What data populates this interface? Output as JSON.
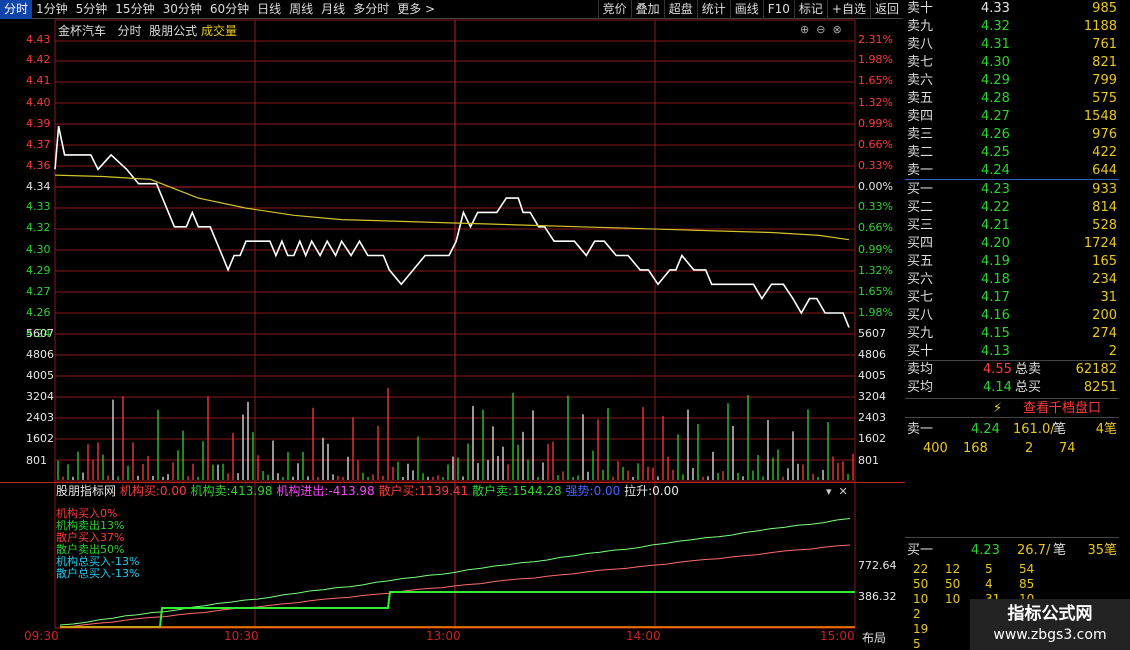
{
  "toolbar": {
    "periods": [
      "分时",
      "1分钟",
      "5分钟",
      "15分钟",
      "30分钟",
      "60分钟",
      "日线",
      "周线",
      "月线",
      "多分时",
      "更多 >"
    ],
    "tools": [
      "竞价",
      "叠加",
      "超盘",
      "统计",
      "画线",
      "F10",
      "标记",
      "+自选",
      "返回"
    ]
  },
  "title": {
    "stock": "金杯汽车",
    "mode": "分时",
    "indicator": "股朋公式",
    "vol_label": "成交量"
  },
  "price_axis": {
    "left": [
      "4.43",
      "4.42",
      "4.41",
      "4.40",
      "4.39",
      "4.37",
      "4.36",
      "4.34",
      "4.33",
      "4.32",
      "4.30",
      "4.29",
      "4.27",
      "4.26",
      "4.24"
    ],
    "right": [
      "2.31%",
      "1.98%",
      "1.65%",
      "1.32%",
      "0.99%",
      "0.66%",
      "0.33%",
      "0.00%",
      "0.33%",
      "0.66%",
      "0.99%",
      "1.32%",
      "1.65%",
      "1.98%"
    ]
  },
  "volume_axis": [
    "5607",
    "4806",
    "4005",
    "3204",
    "2403",
    "1602",
    "801"
  ],
  "indicator": {
    "name": "股朋指标网",
    "buy_label": "机构买:",
    "buy_val": "0.00",
    "sell_label": "机构卖:",
    "sell_val": "413.98",
    "net_label": "机构进出:",
    "net_val": "-413.98",
    "rbuy_label": "散户买:",
    "rbuy_val": "1139.41",
    "rsell_label": "散户卖:",
    "rsell_val": "1544.28",
    "strong_label": "强势:",
    "strong_val": "0.00",
    "pull_label": "拉升:",
    "pull_val": "0.00",
    "axis": [
      "772.64",
      "386.32"
    ],
    "legend": [
      "机构买入0%",
      "机构卖出13%",
      "散户买入37%",
      "散户卖出50%",
      "机构总买入-13%",
      "散户总买入-13%"
    ]
  },
  "time_axis": [
    "09:30",
    "10:30",
    "13:00",
    "14:00",
    "15:00"
  ],
  "layout_button": "布局",
  "orderbook": {
    "sell": [
      {
        "label": "卖十",
        "price": "4.33",
        "vol": "985"
      },
      {
        "label": "卖九",
        "price": "4.32",
        "vol": "1188"
      },
      {
        "label": "卖八",
        "price": "4.31",
        "vol": "761"
      },
      {
        "label": "卖七",
        "price": "4.30",
        "vol": "821"
      },
      {
        "label": "卖六",
        "price": "4.29",
        "vol": "799"
      },
      {
        "label": "卖五",
        "price": "4.28",
        "vol": "575"
      },
      {
        "label": "卖四",
        "price": "4.27",
        "vol": "1548"
      },
      {
        "label": "卖三",
        "price": "4.26",
        "vol": "976"
      },
      {
        "label": "卖二",
        "price": "4.25",
        "vol": "422"
      },
      {
        "label": "卖一",
        "price": "4.24",
        "vol": "644"
      }
    ],
    "buy": [
      {
        "label": "买一",
        "price": "4.23",
        "vol": "933"
      },
      {
        "label": "买二",
        "price": "4.22",
        "vol": "814"
      },
      {
        "label": "买三",
        "price": "4.21",
        "vol": "528"
      },
      {
        "label": "买四",
        "price": "4.20",
        "vol": "1724"
      },
      {
        "label": "买五",
        "price": "4.19",
        "vol": "165"
      },
      {
        "label": "买六",
        "price": "4.18",
        "vol": "234"
      },
      {
        "label": "买七",
        "price": "4.17",
        "vol": "31"
      },
      {
        "label": "买八",
        "price": "4.16",
        "vol": "200"
      },
      {
        "label": "买九",
        "price": "4.15",
        "vol": "274"
      },
      {
        "label": "买十",
        "price": "4.13",
        "vol": "2"
      }
    ],
    "avg_sell_label": "卖均",
    "avg_sell": "4.55",
    "total_sell_label": "总卖",
    "total_sell": "62182",
    "avg_buy_label": "买均",
    "avg_buy": "4.14",
    "total_buy_label": "总买",
    "total_buy": "8251"
  },
  "qiandang": "查看千档盘口",
  "queue_sell": {
    "label": "卖一",
    "price": "4.24",
    "amt": "161.0/",
    "unit": "笔",
    "count": "4笔",
    "items": [
      "400",
      "168",
      "2",
      "74"
    ]
  },
  "queue_buy": {
    "label": "买一",
    "price": "4.23",
    "amt": "26.7/",
    "unit": "笔",
    "count": "35笔",
    "rows": [
      [
        "22",
        "12",
        "5",
        "54"
      ],
      [
        "50",
        "50",
        "4",
        "85"
      ],
      [
        "10",
        "10",
        "31",
        "10"
      ],
      [
        "2",
        "",
        "",
        ""
      ],
      [
        "19",
        "",
        "",
        ""
      ],
      [
        "5",
        "",
        "",
        ""
      ]
    ]
  },
  "watermark": {
    "title": "指标公式网",
    "url": "www.zbgs3.com"
  },
  "chart_data": {
    "type": "line",
    "series": [
      {
        "name": "price",
        "color": "#ffffff",
        "points": [
          [
            0,
            4.34
          ],
          [
            3,
            4.37
          ],
          [
            8,
            4.35
          ],
          [
            30,
            4.35
          ],
          [
            36,
            4.34
          ],
          [
            47,
            4.35
          ],
          [
            60,
            4.34
          ],
          [
            70,
            4.33
          ],
          [
            85,
            4.33
          ],
          [
            100,
            4.3
          ],
          [
            110,
            4.3
          ],
          [
            115,
            4.31
          ],
          [
            120,
            4.3
          ],
          [
            130,
            4.3
          ],
          [
            140,
            4.28
          ],
          [
            145,
            4.27
          ],
          [
            150,
            4.28
          ],
          [
            155,
            4.28
          ],
          [
            160,
            4.29
          ],
          [
            170,
            4.29
          ],
          [
            180,
            4.29
          ],
          [
            185,
            4.28
          ],
          [
            190,
            4.29
          ],
          [
            195,
            4.28
          ],
          [
            200,
            4.28
          ],
          [
            205,
            4.29
          ],
          [
            210,
            4.28
          ],
          [
            215,
            4.29
          ],
          [
            222,
            4.28
          ],
          [
            228,
            4.29
          ],
          [
            235,
            4.28
          ],
          [
            240,
            4.29
          ],
          [
            248,
            4.28
          ],
          [
            255,
            4.29
          ],
          [
            262,
            4.28
          ],
          [
            268,
            4.28
          ],
          [
            275,
            4.28
          ],
          [
            280,
            4.27
          ],
          [
            290,
            4.26
          ],
          [
            300,
            4.27
          ],
          [
            310,
            4.28
          ],
          [
            318,
            4.28
          ],
          [
            322,
            4.28
          ],
          [
            330,
            4.28
          ],
          [
            336,
            4.29
          ],
          [
            342,
            4.31
          ],
          [
            348,
            4.3
          ],
          [
            354,
            4.31
          ],
          [
            360,
            4.31
          ],
          [
            370,
            4.31
          ],
          [
            378,
            4.32
          ],
          [
            388,
            4.32
          ],
          [
            392,
            4.31
          ],
          [
            398,
            4.31
          ],
          [
            405,
            4.3
          ],
          [
            410,
            4.3
          ],
          [
            418,
            4.29
          ],
          [
            425,
            4.29
          ],
          [
            435,
            4.29
          ],
          [
            445,
            4.28
          ],
          [
            452,
            4.29
          ],
          [
            460,
            4.29
          ],
          [
            470,
            4.28
          ],
          [
            480,
            4.28
          ],
          [
            490,
            4.27
          ],
          [
            497,
            4.27
          ],
          [
            505,
            4.26
          ],
          [
            515,
            4.27
          ],
          [
            520,
            4.27
          ],
          [
            525,
            4.28
          ],
          [
            535,
            4.27
          ],
          [
            545,
            4.27
          ],
          [
            550,
            4.26
          ],
          [
            558,
            4.26
          ],
          [
            565,
            4.26
          ],
          [
            575,
            4.26
          ],
          [
            585,
            4.26
          ],
          [
            592,
            4.25
          ],
          [
            600,
            4.26
          ],
          [
            610,
            4.26
          ],
          [
            618,
            4.25
          ],
          [
            625,
            4.24
          ],
          [
            632,
            4.25
          ],
          [
            638,
            4.25
          ],
          [
            645,
            4.24
          ],
          [
            660,
            4.24
          ],
          [
            665,
            4.23
          ]
        ]
      },
      {
        "name": "avg",
        "color": "#d4c32a",
        "points": [
          [
            0,
            4.336
          ],
          [
            40,
            4.335
          ],
          [
            80,
            4.333
          ],
          [
            120,
            4.32
          ],
          [
            160,
            4.313
          ],
          [
            200,
            4.308
          ],
          [
            240,
            4.305
          ],
          [
            280,
            4.304
          ],
          [
            320,
            4.303
          ],
          [
            360,
            4.302
          ],
          [
            400,
            4.301
          ],
          [
            440,
            4.3
          ],
          [
            480,
            4.299
          ],
          [
            520,
            4.298
          ],
          [
            560,
            4.297
          ],
          [
            600,
            4.296
          ],
          [
            640,
            4.294
          ],
          [
            665,
            4.291
          ]
        ]
      }
    ],
    "ylim": [
      4.235,
      4.435
    ],
    "xlim": [
      0,
      670
    ]
  }
}
